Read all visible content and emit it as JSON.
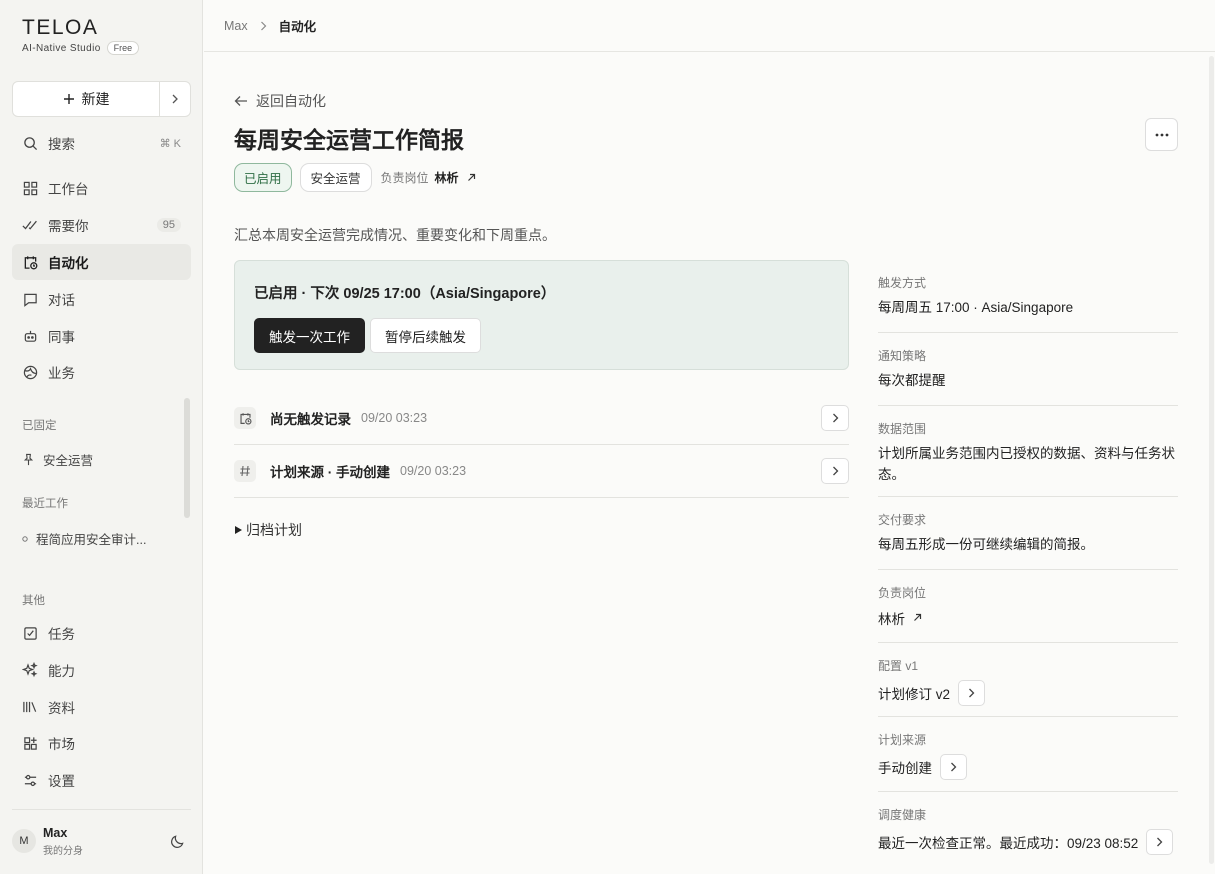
{
  "brand": {
    "name": "TELOA",
    "subtitle": "AI-Native Studio",
    "plan": "Free"
  },
  "sidebar": {
    "new_label": "新建",
    "search": {
      "label": "搜索",
      "shortcut": "⌘ K"
    },
    "items": [
      {
        "label": "工作台",
        "icon": "grid-icon"
      },
      {
        "label": "需要你",
        "icon": "double-check-icon",
        "count": "95"
      },
      {
        "label": "自动化",
        "icon": "calendar-clock-icon"
      },
      {
        "label": "对话",
        "icon": "chat-icon"
      },
      {
        "label": "同事",
        "icon": "robot-icon"
      },
      {
        "label": "业务",
        "icon": "globe-icon"
      }
    ],
    "pinned_title": "已固定",
    "pinned_items": [
      {
        "label": "安全运营",
        "icon": "pin-icon"
      }
    ],
    "recent_title": "最近工作",
    "recent_items": [
      {
        "label": "程简应用安全审计..."
      }
    ],
    "other_title": "其他",
    "other_items": [
      {
        "label": "任务",
        "icon": "check-square-icon"
      },
      {
        "label": "能力",
        "icon": "sparkle-icon"
      },
      {
        "label": "资料",
        "icon": "library-icon"
      },
      {
        "label": "市场",
        "icon": "apps-icon"
      },
      {
        "label": "设置",
        "icon": "sliders-icon"
      }
    ],
    "user": {
      "initial": "M",
      "name": "Max",
      "subtitle": "我的分身"
    }
  },
  "breadcrumb": {
    "parent": "Max",
    "current": "自动化"
  },
  "main": {
    "back_label": "返回自动化",
    "title": "每周安全运营工作简报",
    "status_tag": "已启用",
    "category_tag": "安全运营",
    "owner_label": "负责岗位",
    "owner_name": "林析",
    "description": "汇总本周安全运营完成情况、重要变化和下周重点。",
    "status_card": {
      "text": "已启用 · 下次 09/25 17:00（Asia/Singapore）",
      "primary_button": "触发一次工作",
      "secondary_button": "暂停后续触发"
    },
    "rows": [
      {
        "title": "尚无触发记录",
        "time": "09/20 03:23",
        "icon": "calendar-clock-icon"
      },
      {
        "title": "计划来源 · 手动创建",
        "time": "09/20 03:23",
        "icon": "hash-icon"
      }
    ],
    "archive_label": "归档计划"
  },
  "details": [
    {
      "label": "触发方式",
      "value": "每周周五 17:00 · Asia/Singapore"
    },
    {
      "label": "通知策略",
      "value": "每次都提醒"
    },
    {
      "label": "数据范围",
      "value": "计划所属业务范围内已授权的数据、资料与任务状态。"
    },
    {
      "label": "交付要求",
      "value": "每周五形成一份可继续编辑的简报。"
    },
    {
      "label": "负责岗位",
      "value": "林析"
    },
    {
      "label": "配置 v1",
      "value": "计划修订 v2"
    },
    {
      "label": "计划来源",
      "value": "手动创建"
    },
    {
      "label": "调度健康",
      "value": "最近一次检查正常。最近成功：09/23 08:52"
    }
  ]
}
